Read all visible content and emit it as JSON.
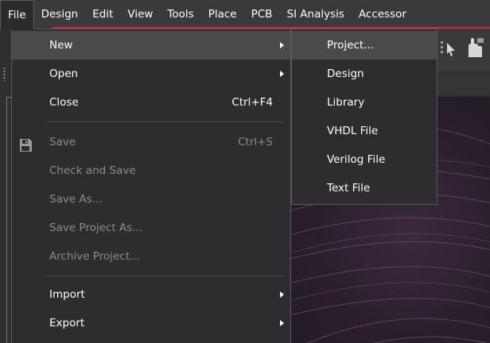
{
  "menubar": {
    "items": [
      {
        "label": "File",
        "active": true
      },
      {
        "label": "Design"
      },
      {
        "label": "Edit"
      },
      {
        "label": "View"
      },
      {
        "label": "Tools"
      },
      {
        "label": "Place"
      },
      {
        "label": "PCB"
      },
      {
        "label": "SI Analysis"
      },
      {
        "label": "Accessor"
      }
    ],
    "accent_color": "#d12a3a"
  },
  "file_menu": {
    "items": [
      {
        "label": "New",
        "submenu": true,
        "highlighted": true
      },
      {
        "label": "Open",
        "submenu": true
      },
      {
        "label": "Close",
        "shortcut": "Ctrl+F4"
      },
      {
        "label": "Save",
        "shortcut": "Ctrl+S",
        "disabled": true,
        "icon": "floppy-disk-icon"
      },
      {
        "label": "Check and Save",
        "disabled": true
      },
      {
        "label": "Save As...",
        "disabled": true
      },
      {
        "label": "Save Project As...",
        "disabled": true
      },
      {
        "label": "Archive Project...",
        "disabled": true
      },
      {
        "label": "Import",
        "submenu": true
      },
      {
        "label": "Export",
        "submenu": true
      }
    ]
  },
  "new_submenu": {
    "items": [
      {
        "label": "Project...",
        "highlighted": true
      },
      {
        "label": "Design"
      },
      {
        "label": "Library"
      },
      {
        "label": "VHDL File"
      },
      {
        "label": "Verilog File"
      },
      {
        "label": "Text File"
      }
    ]
  },
  "colors": {
    "menu_bg": "#2d2d2f",
    "highlight": "#4a4a4c",
    "disabled_text": "#8c8c8c"
  }
}
